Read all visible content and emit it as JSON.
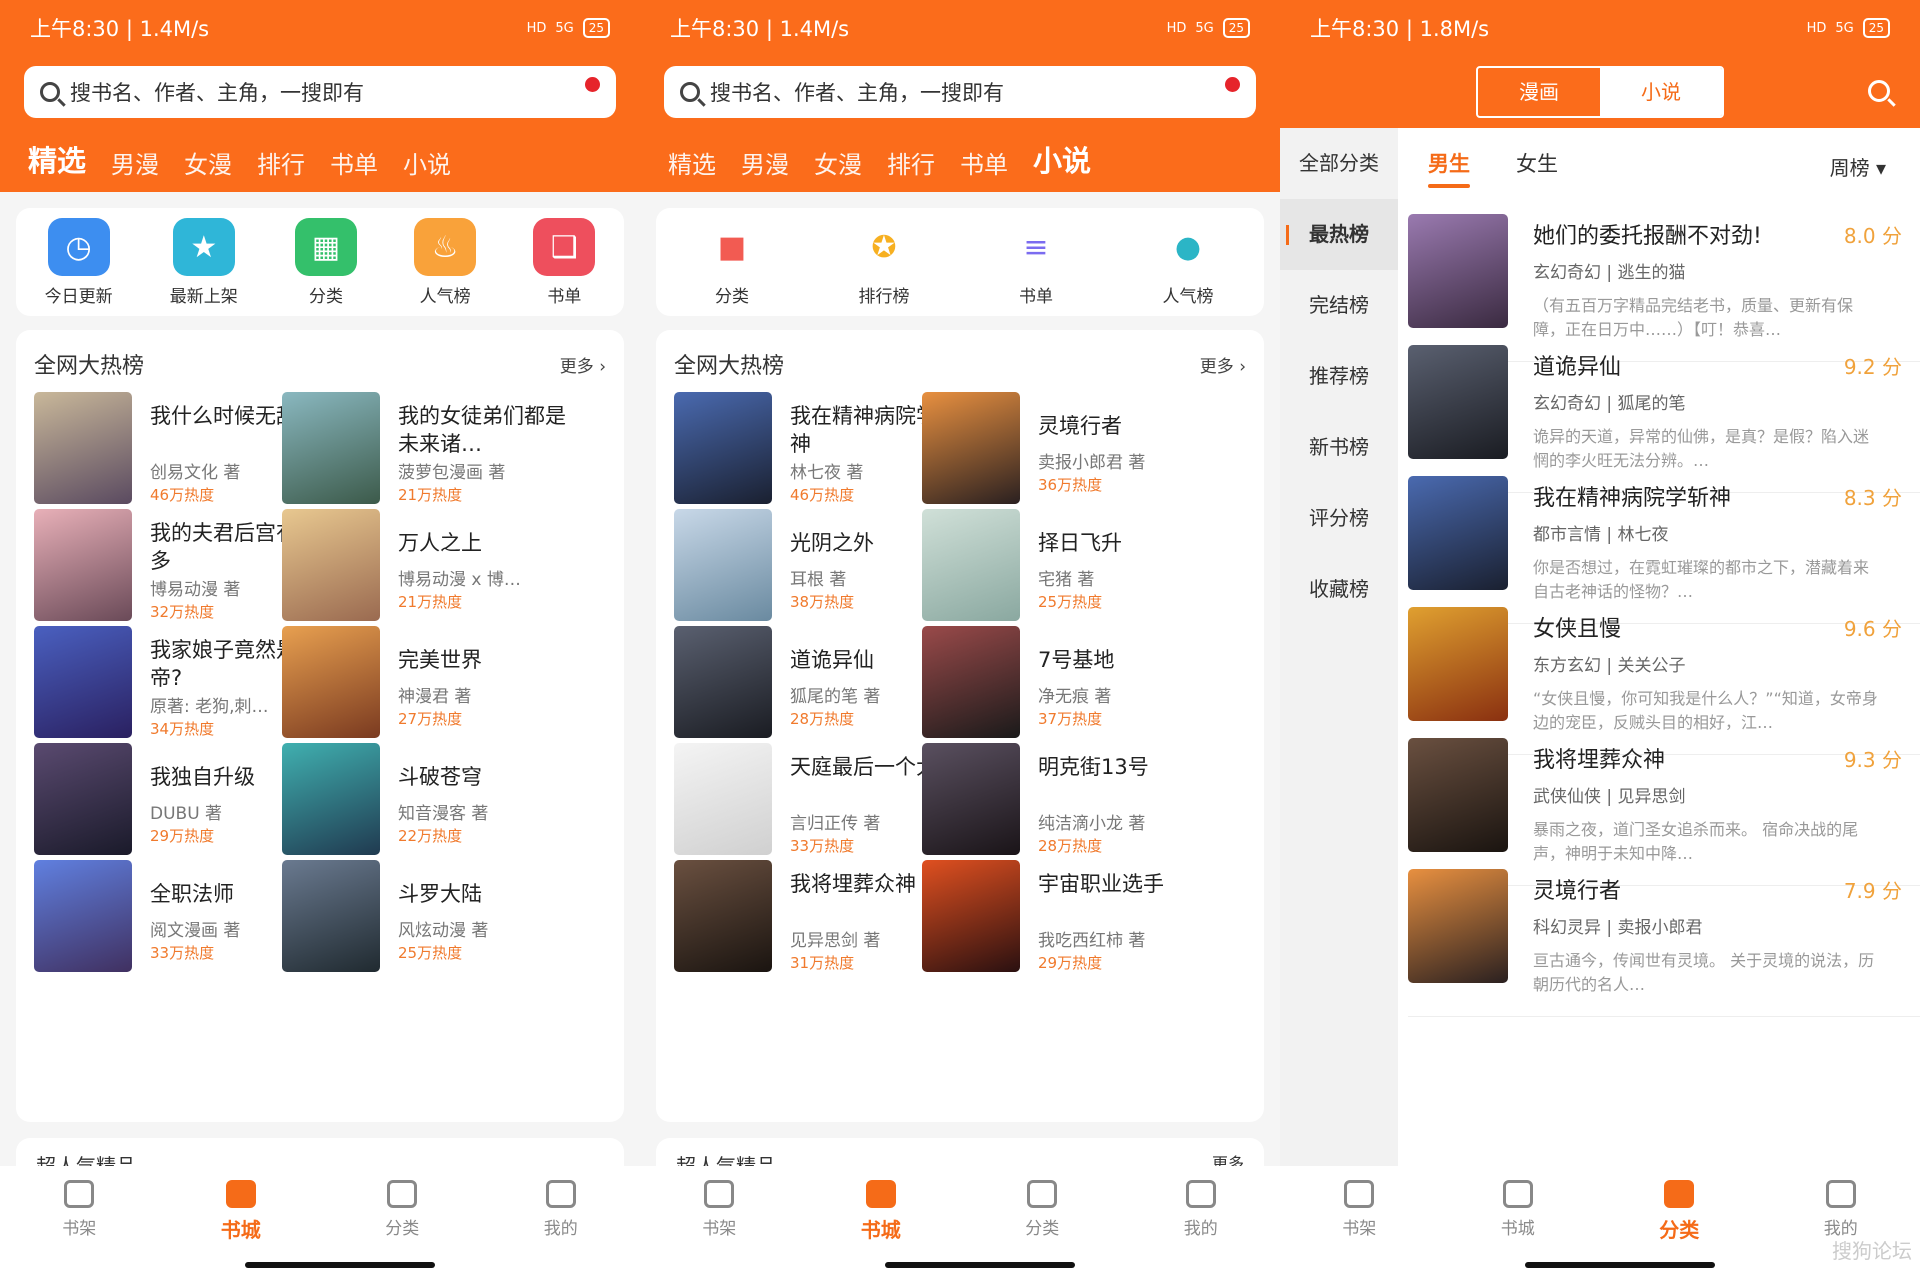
{
  "status": {
    "time": "上午8:30 | 1.4M/s",
    "time3": "上午8:30 | 1.8M/s",
    "hd": "HD",
    "net": "5G",
    "battery": "25"
  },
  "search": {
    "placeholder": "搜书名、作者、主角，一搜即有"
  },
  "tabs": [
    "精选",
    "男漫",
    "女漫",
    "排行",
    "书单",
    "小说"
  ],
  "p1": {
    "icons": [
      {
        "label": "今日更新",
        "color": "#3d8ef0",
        "glyph": "clock-icon"
      },
      {
        "label": "最新上架",
        "color": "#2fb6d8",
        "glyph": "star-icon"
      },
      {
        "label": "分类",
        "color": "#34c06b",
        "glyph": "grid-icon"
      },
      {
        "label": "人气榜",
        "color": "#f9a23a",
        "glyph": "flame-icon"
      },
      {
        "label": "书单",
        "color": "#ee4f5d",
        "glyph": "bookmark-icon"
      }
    ],
    "list_title": "全网大热榜",
    "more": "更多",
    "books": [
      {
        "title": "我什么时候无敌了",
        "author": "创易文化 著",
        "heat": "46万热度",
        "c1": "#c9b89a",
        "c2": "#5a4a60"
      },
      {
        "title": "我的女徒弟们都是未来诸…",
        "author": "菠萝包漫画 著",
        "heat": "21万热度",
        "c1": "#8ab8c0",
        "c2": "#3c5a4a"
      },
      {
        "title": "我的夫君后宫有点多",
        "author": "博易动漫 著",
        "heat": "32万热度",
        "c1": "#e8b0b8",
        "c2": "#6a4a58"
      },
      {
        "title": "万人之上",
        "author": "博易动漫 x 博…",
        "heat": "21万热度",
        "c1": "#e8c890",
        "c2": "#9a6a50"
      },
      {
        "title": "我家娘子竟然是女帝?",
        "author": "原著: 老狗,刺…",
        "heat": "34万热度",
        "c1": "#4a60c0",
        "c2": "#2a2060"
      },
      {
        "title": "完美世界",
        "author": "神漫君 著",
        "heat": "27万热度",
        "c1": "#e8a050",
        "c2": "#7a3a20"
      },
      {
        "title": "我独自升级",
        "author": "DUBU 著",
        "heat": "29万热度",
        "c1": "#5a4a70",
        "c2": "#1a1a2a"
      },
      {
        "title": "斗破苍穹",
        "author": "知音漫客 著",
        "heat": "22万热度",
        "c1": "#40b0b0",
        "c2": "#203a50"
      },
      {
        "title": "全职法师",
        "author": "阅文漫画 著",
        "heat": "33万热度",
        "c1": "#6080e0",
        "c2": "#403060"
      },
      {
        "title": "斗罗大陆",
        "author": "风炫动漫 著",
        "heat": "25万热度",
        "c1": "#6a7a90",
        "c2": "#202a30"
      }
    ],
    "peek": "超人气精品"
  },
  "p2": {
    "icons": [
      {
        "label": "分类",
        "color": "#f25b52",
        "glyph": "category-icon"
      },
      {
        "label": "排行榜",
        "color": "#f7b021",
        "glyph": "medal-icon"
      },
      {
        "label": "书单",
        "color": "#7b6cf0",
        "glyph": "list-icon"
      },
      {
        "label": "人气榜",
        "color": "#2bb5c6",
        "glyph": "drop-icon"
      }
    ],
    "list_title": "全网大热榜",
    "more": "更多",
    "books": [
      {
        "title": "我在精神病院学斩神",
        "author": "林七夜 著",
        "heat": "46万热度",
        "c1": "#4a6ab0",
        "c2": "#1a2030"
      },
      {
        "title": "灵境行者",
        "author": "卖报小郎君 著",
        "heat": "36万热度",
        "c1": "#e89040",
        "c2": "#2a2020"
      },
      {
        "title": "光阴之外",
        "author": "耳根 著",
        "heat": "38万热度",
        "c1": "#c8d8e8",
        "c2": "#6a8aa0"
      },
      {
        "title": "择日飞升",
        "author": "宅猪 著",
        "heat": "25万热度",
        "c1": "#d0e0d8",
        "c2": "#8aa8a0"
      },
      {
        "title": "道诡异仙",
        "author": "狐尾的笔 著",
        "heat": "28万热度",
        "c1": "#5a6070",
        "c2": "#1a1c22"
      },
      {
        "title": "7号基地",
        "author": "净无痕 著",
        "heat": "37万热度",
        "c1": "#9a4a4a",
        "c2": "#1a1a1a"
      },
      {
        "title": "天庭最后一个大佬",
        "author": "言归正传 著",
        "heat": "33万热度",
        "c1": "#f4f4f4",
        "c2": "#d0d0d0"
      },
      {
        "title": "明克街13号",
        "author": "纯洁滴小龙 著",
        "heat": "28万热度",
        "c1": "#5a5060",
        "c2": "#1a1418"
      },
      {
        "title": "我将埋葬众神",
        "author": "见异思剑 著",
        "heat": "31万热度",
        "c1": "#6a5040",
        "c2": "#1a1410"
      },
      {
        "title": "宇宙职业选手",
        "author": "我吃西红柿 著",
        "heat": "29万热度",
        "c1": "#e05020",
        "c2": "#2a1010"
      }
    ],
    "peek": "超人气精品",
    "peek_more": "更多"
  },
  "p3": {
    "seg": [
      "漫画",
      "小说"
    ],
    "side": [
      "全部分类",
      "最热榜",
      "完结榜",
      "推荐榜",
      "新书榜",
      "评分榜",
      "收藏榜"
    ],
    "gender": [
      "男生",
      "女生"
    ],
    "sort": "周榜",
    "books": [
      {
        "title": "她们的委托报酬不对劲!",
        "score": "8.0 分",
        "meta": "玄幻奇幻 | 逃生的猫",
        "desc": "（有五百万字精品完结老书，质量、更新有保障，正在日万中……）【叮！恭喜…",
        "c1": "#9a7ab0",
        "c2": "#3a2a40"
      },
      {
        "title": "道诡异仙",
        "score": "9.2 分",
        "meta": "玄幻奇幻 | 狐尾的笔",
        "desc": "诡异的天道，异常的仙佛，是真？是假？陷入迷惘的李火旺无法分辨。…",
        "c1": "#5a6070",
        "c2": "#1a1c22"
      },
      {
        "title": "我在精神病院学斩神",
        "score": "8.3 分",
        "meta": "都市言情 | 林七夜",
        "desc": "你是否想过，在霓虹璀璨的都市之下，潜藏着来自古老神话的怪物？…",
        "c1": "#4a6ab0",
        "c2": "#1a2030"
      },
      {
        "title": "女侠且慢",
        "score": "9.6 分",
        "meta": "东方玄幻 | 关关公子",
        "desc": "“女侠且慢，你可知我是什么人？”“知道，女帝身边的宠臣，反贼头目的相好，江…",
        "c1": "#e0a030",
        "c2": "#8a3010"
      },
      {
        "title": "我将埋葬众神",
        "score": "9.3 分",
        "meta": "武侠仙侠 | 见异思剑",
        "desc": "暴雨之夜，道门圣女追杀而来。 宿命决战的尾声，神明于未知中降…",
        "c1": "#6a5040",
        "c2": "#1a1410"
      },
      {
        "title": "灵境行者",
        "score": "7.9 分",
        "meta": "科幻灵异 | 卖报小郎君",
        "desc": "亘古通今，传闻世有灵境。 关于灵境的说法，历朝历代的名人…",
        "c1": "#e89040",
        "c2": "#2a2020"
      }
    ]
  },
  "nav": [
    {
      "label": "书架",
      "icon": "shelf-icon"
    },
    {
      "label": "书城",
      "icon": "store-icon"
    },
    {
      "label": "分类",
      "icon": "category-icon"
    },
    {
      "label": "我的",
      "icon": "user-icon"
    }
  ],
  "watermark": "搜狗论坛",
  "colors": {
    "accent": "#fb6c1b",
    "heat": "#f07a2d",
    "score": "#f0a23c"
  }
}
